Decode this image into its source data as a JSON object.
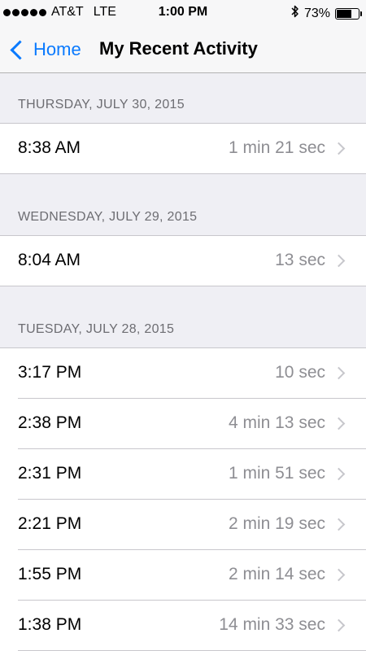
{
  "status_bar": {
    "carrier": "AT&T",
    "network": "LTE",
    "time": "1:00 PM",
    "bluetooth_icon": "bluetooth-icon",
    "battery_percent": "73%",
    "battery_level": 0.73
  },
  "nav": {
    "back_label": "Home",
    "title": "My Recent Activity"
  },
  "sections": [
    {
      "date": "THURSDAY, JULY 30, 2015",
      "items": [
        {
          "time": "8:38 AM",
          "duration": "1 min 21 sec"
        }
      ]
    },
    {
      "date": "WEDNESDAY, JULY 29, 2015",
      "items": [
        {
          "time": "8:04 AM",
          "duration": "13 sec"
        }
      ]
    },
    {
      "date": "TUESDAY, JULY 28, 2015",
      "items": [
        {
          "time": "3:17 PM",
          "duration": "10 sec"
        },
        {
          "time": "2:38 PM",
          "duration": "4 min 13 sec"
        },
        {
          "time": "2:31 PM",
          "duration": "1 min 51 sec"
        },
        {
          "time": "2:21 PM",
          "duration": "2 min 19 sec"
        },
        {
          "time": "1:55 PM",
          "duration": "2 min 14 sec"
        },
        {
          "time": "1:38 PM",
          "duration": "14 min 33 sec"
        }
      ]
    }
  ],
  "colors": {
    "accent": "#0a7afe",
    "background": "#efeff4",
    "secondary_text": "#8e8e93"
  }
}
